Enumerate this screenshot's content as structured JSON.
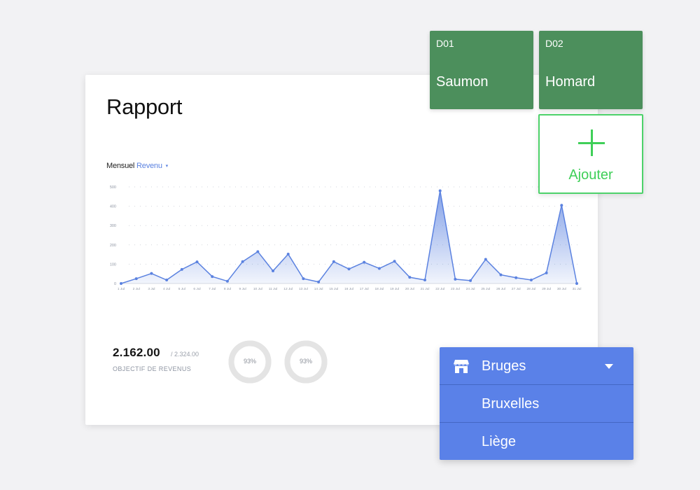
{
  "report": {
    "title": "Rapport",
    "period_label": "Mensuel",
    "metric_label": "Revenu",
    "metric_caret": "▾",
    "goal_value": "2.162.00",
    "goal_total": "/ 2.324.00",
    "goal_label": "OBJECTIF DE REVENUS",
    "donuts": [
      {
        "label": "93%",
        "percent": 93
      },
      {
        "label": "93%",
        "percent": 93
      }
    ]
  },
  "colors": {
    "line": "#5b82e0",
    "tile": "#4c8f5c",
    "add_accent": "#3fcf58",
    "dropdown": "#5a81e8",
    "donut_track": "#e4e4e4"
  },
  "chart_data": {
    "type": "area",
    "x": [
      "1 Jul",
      "2 Jul",
      "3 Jul",
      "4 Jul",
      "5 Jul",
      "6 Jul",
      "7 Jul",
      "8 Jul",
      "9 Jul",
      "10 Jul",
      "11 Jul",
      "12 Jul",
      "13 Jul",
      "14 Jul",
      "15 Jul",
      "16 Jul",
      "17 Jul",
      "18 Jul",
      "19 Jul",
      "20 Jul",
      "21 Jul",
      "22 Jul",
      "23 Jul",
      "24 Jul",
      "25 Jul",
      "26 Jul",
      "27 Jul",
      "28 Jul",
      "29 Jul",
      "30 Jul",
      "31 Jul"
    ],
    "values": [
      0,
      25,
      52,
      18,
      73,
      112,
      36,
      12,
      113,
      165,
      65,
      152,
      25,
      8,
      113,
      75,
      110,
      78,
      115,
      32,
      18,
      480,
      22,
      15,
      125,
      45,
      30,
      18,
      55,
      405,
      0
    ],
    "ylim": [
      0,
      500
    ],
    "yticks": [
      0,
      100,
      200,
      300,
      400,
      500
    ],
    "ytick_labels": [
      "0",
      "100",
      "200",
      "300",
      "400",
      "500"
    ],
    "grid": true,
    "series": [
      {
        "name": "Revenu"
      }
    ]
  },
  "tiles": [
    {
      "code": "D01",
      "name": "Saumon"
    },
    {
      "code": "D02",
      "name": "Homard"
    }
  ],
  "add_tile": {
    "label": "Ajouter",
    "icon": "plus-icon"
  },
  "dropdown": {
    "selected": "Bruges",
    "icon": "store-icon",
    "options": [
      "Bruxelles",
      "Liège"
    ]
  }
}
